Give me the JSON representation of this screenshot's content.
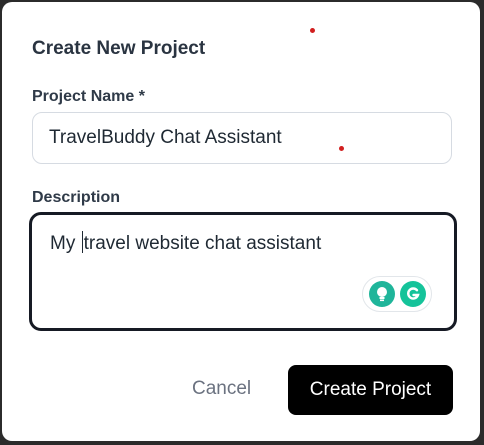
{
  "dialog": {
    "title": "Create New Project",
    "project_name_label": "Project Name *",
    "project_name_value": "TravelBuddy Chat Assistant",
    "description_label": "Description",
    "description_value_before_caret": "My ",
    "description_value_after_caret": "travel website chat assistant",
    "cancel_label": "Cancel",
    "create_label": "Create Project"
  },
  "icons": {
    "bulb": "lightbulb-icon",
    "grammarly": "grammarly-icon"
  },
  "colors": {
    "primary_button": "#000000",
    "focus_border": "#161a24",
    "grammarly_green": "#15c39a",
    "marker_dot": "#d11f1f"
  }
}
